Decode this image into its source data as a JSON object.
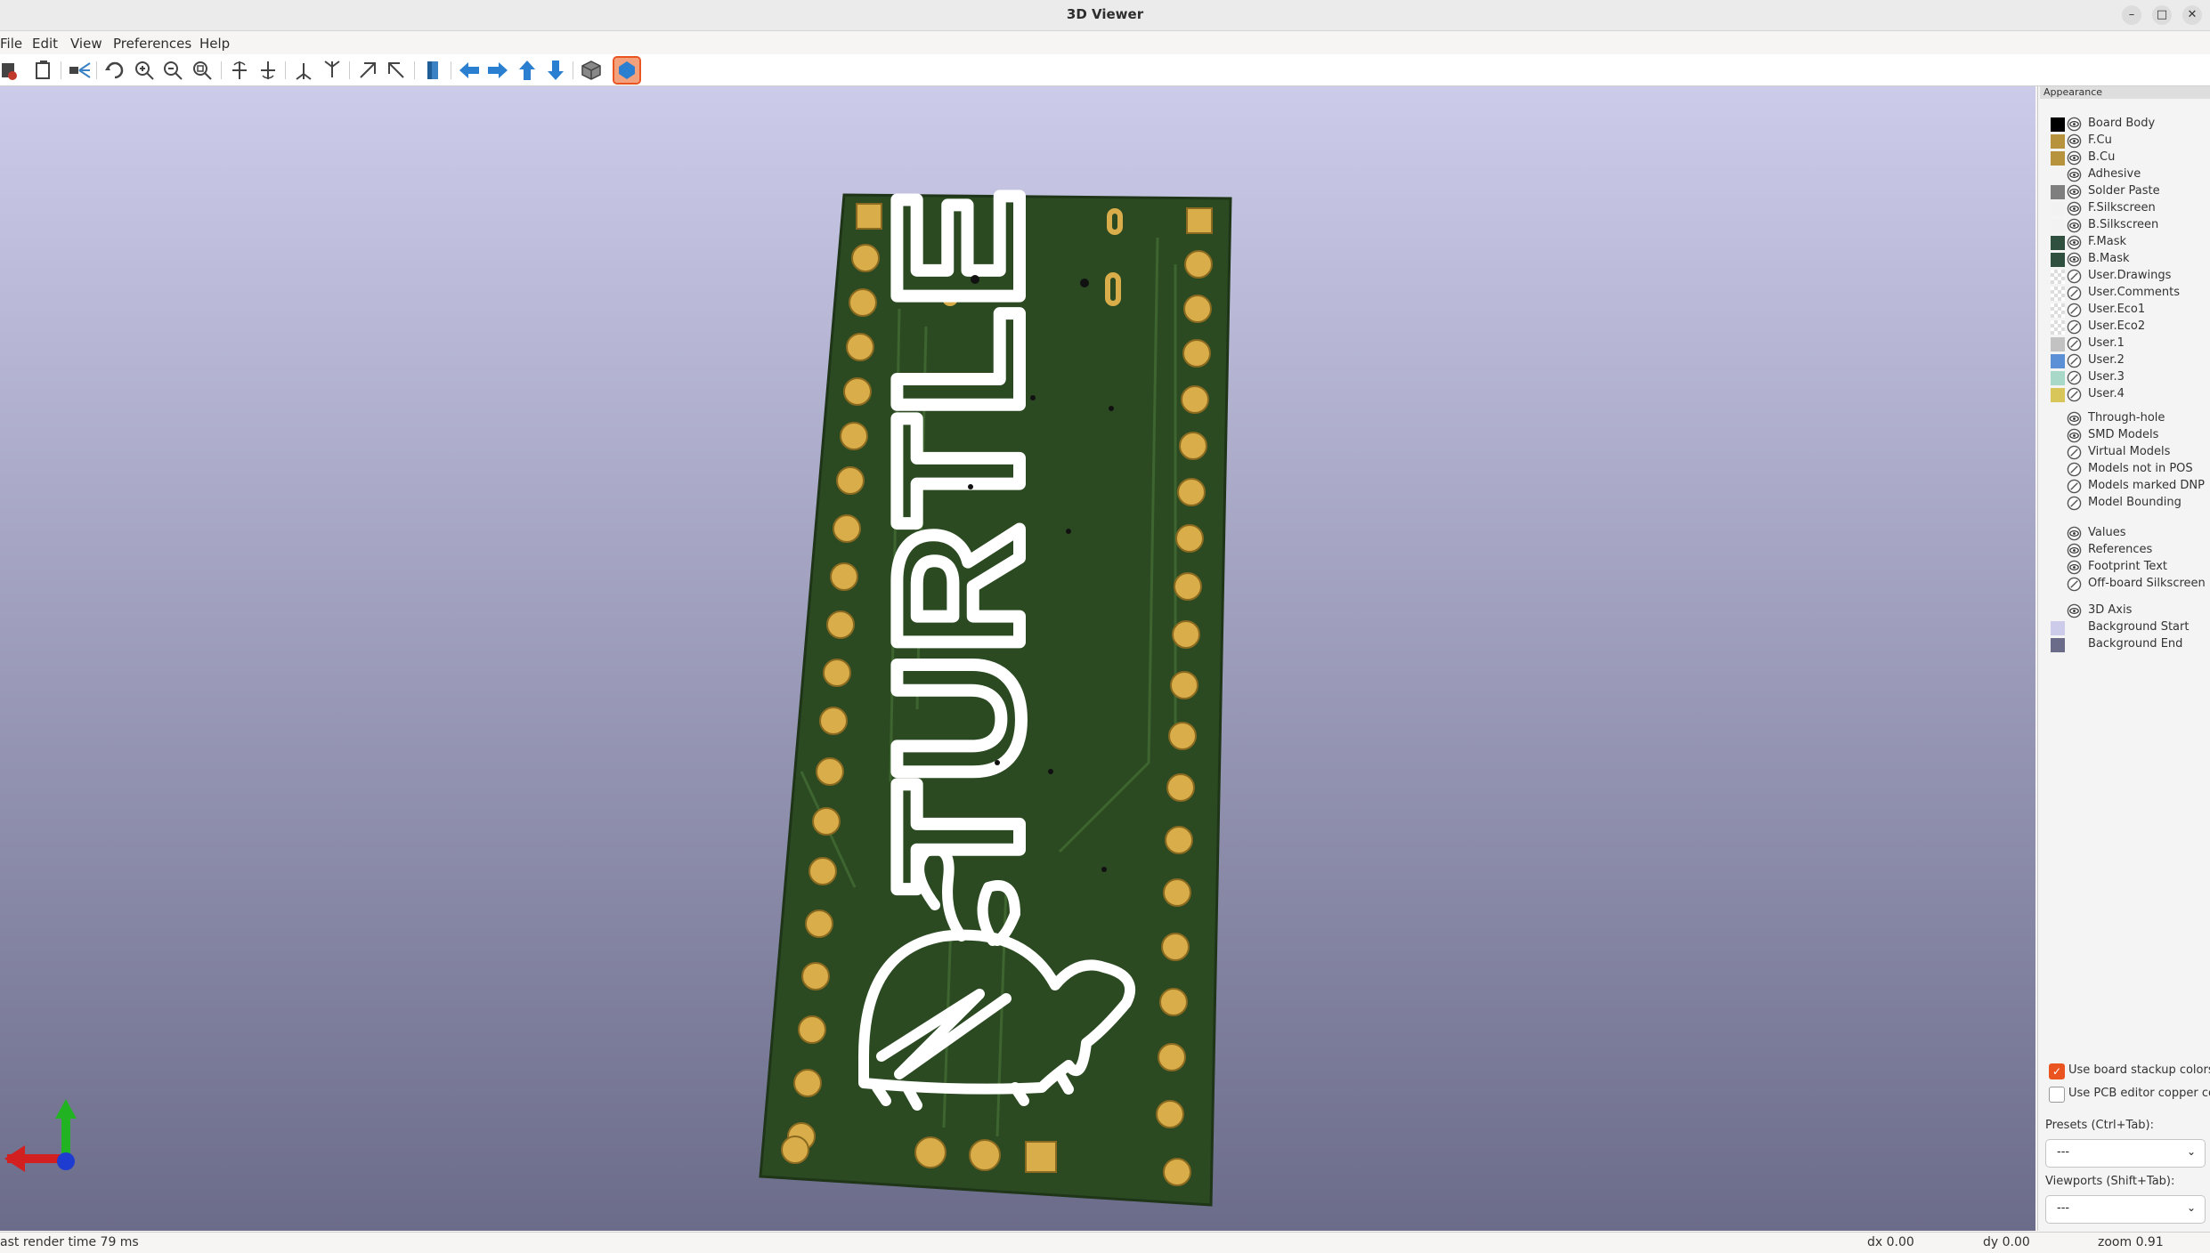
{
  "window": {
    "title": "3D Viewer",
    "buttons": [
      "–",
      "□",
      "✕"
    ]
  },
  "menu": [
    "File",
    "Edit",
    "View",
    "Preferences",
    "Help"
  ],
  "toolbar": {
    "icons": [
      "export-icon",
      "copy-icon",
      "raytrace-icon",
      "reload-icon",
      "zoom-in-icon",
      "zoom-out-icon",
      "zoom-fit-icon",
      "rotate-x-cw-icon",
      "rotate-x-ccw-icon",
      "rotate-y-cw-icon",
      "rotate-y-ccw-icon",
      "rotate-z-cw-icon",
      "rotate-z-ccw-icon",
      "flip-board-icon",
      "pan-left-icon",
      "pan-right-icon",
      "pan-up-icon",
      "pan-down-icon",
      "ortho-icon",
      "layers-toggle-icon"
    ]
  },
  "panel": {
    "title": "Appearance",
    "layers": [
      {
        "name": "Board Body",
        "color": "#000000",
        "eye": true
      },
      {
        "name": "F.Cu",
        "color": "#b8933e",
        "eye": true
      },
      {
        "name": "B.Cu",
        "color": "#b8933e",
        "eye": true
      },
      {
        "name": "Adhesive",
        "color": "",
        "eye": true
      },
      {
        "name": "Solder Paste",
        "color": "#7f7f7f",
        "eye": true
      },
      {
        "name": "F.Silkscreen",
        "color": "#f2f2f2",
        "eye": true
      },
      {
        "name": "B.Silkscreen",
        "color": "#f2f2f2",
        "eye": true
      },
      {
        "name": "F.Mask",
        "color": "#2f4f3f",
        "eye": true
      },
      {
        "name": "B.Mask",
        "color": "#2f4f3f",
        "eye": true
      },
      {
        "name": "User.Drawings",
        "color": "checker",
        "eye": false
      },
      {
        "name": "User.Comments",
        "color": "checker",
        "eye": false
      },
      {
        "name": "User.Eco1",
        "color": "checker",
        "eye": false
      },
      {
        "name": "User.Eco2",
        "color": "checker",
        "eye": false
      },
      {
        "name": "User.1",
        "color": "#c2c2c2",
        "eye": false
      },
      {
        "name": "User.2",
        "color": "#5b8fd6",
        "eye": false
      },
      {
        "name": "User.3",
        "color": "#a8d8c8",
        "eye": false
      },
      {
        "name": "User.4",
        "color": "#d8c65a",
        "eye": false
      }
    ],
    "objects": [
      {
        "name": "Through-hole",
        "eye": true
      },
      {
        "name": "SMD Models",
        "eye": true
      },
      {
        "name": "Virtual Models",
        "eye": false
      },
      {
        "name": "Models not in POS",
        "eye": false
      },
      {
        "name": "Models marked DNP",
        "eye": false
      },
      {
        "name": "Model Bounding",
        "eye": false
      }
    ],
    "text": [
      {
        "name": "Values",
        "eye": true
      },
      {
        "name": "References",
        "eye": true
      },
      {
        "name": "Footprint Text",
        "eye": true
      },
      {
        "name": "Off-board Silkscreen",
        "eye": false
      }
    ],
    "misc": [
      {
        "name": "3D Axis",
        "color": "",
        "eye": true
      },
      {
        "name": "Background Start",
        "color": "#ccccea",
        "eye": null
      },
      {
        "name": "Background End",
        "color": "#6b6c8a",
        "eye": null
      }
    ],
    "use_stackup_colors": {
      "label": "Use board stackup colors",
      "checked": true
    },
    "use_pcb_copper": {
      "label": "Use PCB editor copper colo",
      "checked": false
    },
    "presets_label": "Presets (Ctrl+Tab):",
    "presets_value": "---",
    "viewports_label": "Viewports (Shift+Tab):",
    "viewports_value": "---"
  },
  "board": {
    "silk_text": "TURTLE"
  },
  "status": {
    "render_time": "ast render time 79 ms",
    "dx": "dx 0.00",
    "dy": "dy 0.00",
    "zoom": "zoom 0.91"
  }
}
